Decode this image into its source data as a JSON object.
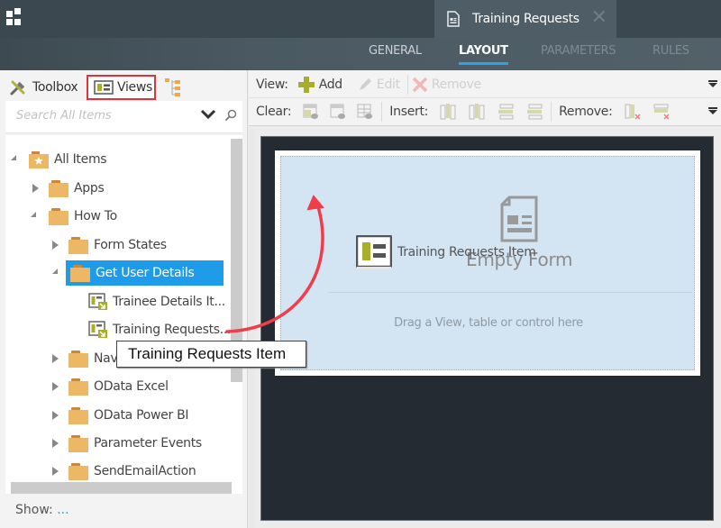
{
  "header": {
    "app_icon": "app-grid-icon",
    "document_tab": {
      "title": "Training Requests",
      "icon": "form-document-icon",
      "close_icon": "close-icon"
    },
    "tabs": [
      {
        "label": "GENERAL",
        "active": false
      },
      {
        "label": "LAYOUT",
        "active": true
      },
      {
        "label": "PARAMETERS",
        "active": false
      },
      {
        "label": "RULES",
        "active": false
      }
    ],
    "accent_color": "#2aa3e8"
  },
  "left_panel": {
    "tabs": [
      {
        "label": "Toolbox",
        "icon": "tools-icon"
      },
      {
        "label": "Views",
        "icon": "view-icon",
        "highlighted": true
      },
      {
        "label": "",
        "icon": "tree-outline-icon"
      }
    ],
    "search": {
      "placeholder": "Search All Items",
      "value": ""
    },
    "tree": [
      {
        "label": "All Items",
        "icon": "star-folder-icon",
        "expanded": true,
        "level": 0
      },
      {
        "label": "Apps",
        "icon": "folder-icon",
        "expanded": false,
        "level": 1
      },
      {
        "label": "How To",
        "icon": "folder-icon",
        "expanded": true,
        "level": 1
      },
      {
        "label": "Form States",
        "icon": "folder-icon",
        "expanded": false,
        "level": 2
      },
      {
        "label": "Get User Details",
        "icon": "folder-icon",
        "expanded": true,
        "level": 2,
        "selected": true
      },
      {
        "label": "Trainee Details It...",
        "icon": "item-view-icon",
        "level": 3
      },
      {
        "label": "Training Requests...",
        "icon": "item-view-icon",
        "level": 3
      },
      {
        "label": "Nav",
        "icon": "folder-icon",
        "expanded": false,
        "level": 2
      },
      {
        "label": "OData Excel",
        "icon": "folder-icon",
        "expanded": false,
        "level": 2
      },
      {
        "label": "OData Power BI",
        "icon": "folder-icon",
        "expanded": false,
        "level": 2
      },
      {
        "label": "Parameter Events",
        "icon": "folder-icon",
        "expanded": false,
        "level": 2
      },
      {
        "label": "SendEmailAction",
        "icon": "folder-icon",
        "expanded": false,
        "level": 2
      }
    ],
    "show_label": "Show:",
    "show_value": "..."
  },
  "toolbar": {
    "row1": {
      "label": "View:",
      "add_label": "Add",
      "edit_label": "Edit",
      "remove_label": "Remove"
    },
    "row2": {
      "clear_label": "Clear:",
      "insert_label": "Insert:",
      "remove_label": "Remove:"
    }
  },
  "canvas": {
    "empty_title": "Empty Form",
    "drag_hint": "Drag a View, table or control here",
    "drag_ghost_label": "Training Requests Item"
  },
  "tooltip": {
    "text": "Training Requests Item"
  },
  "annotation_color": "#ef3e4a"
}
